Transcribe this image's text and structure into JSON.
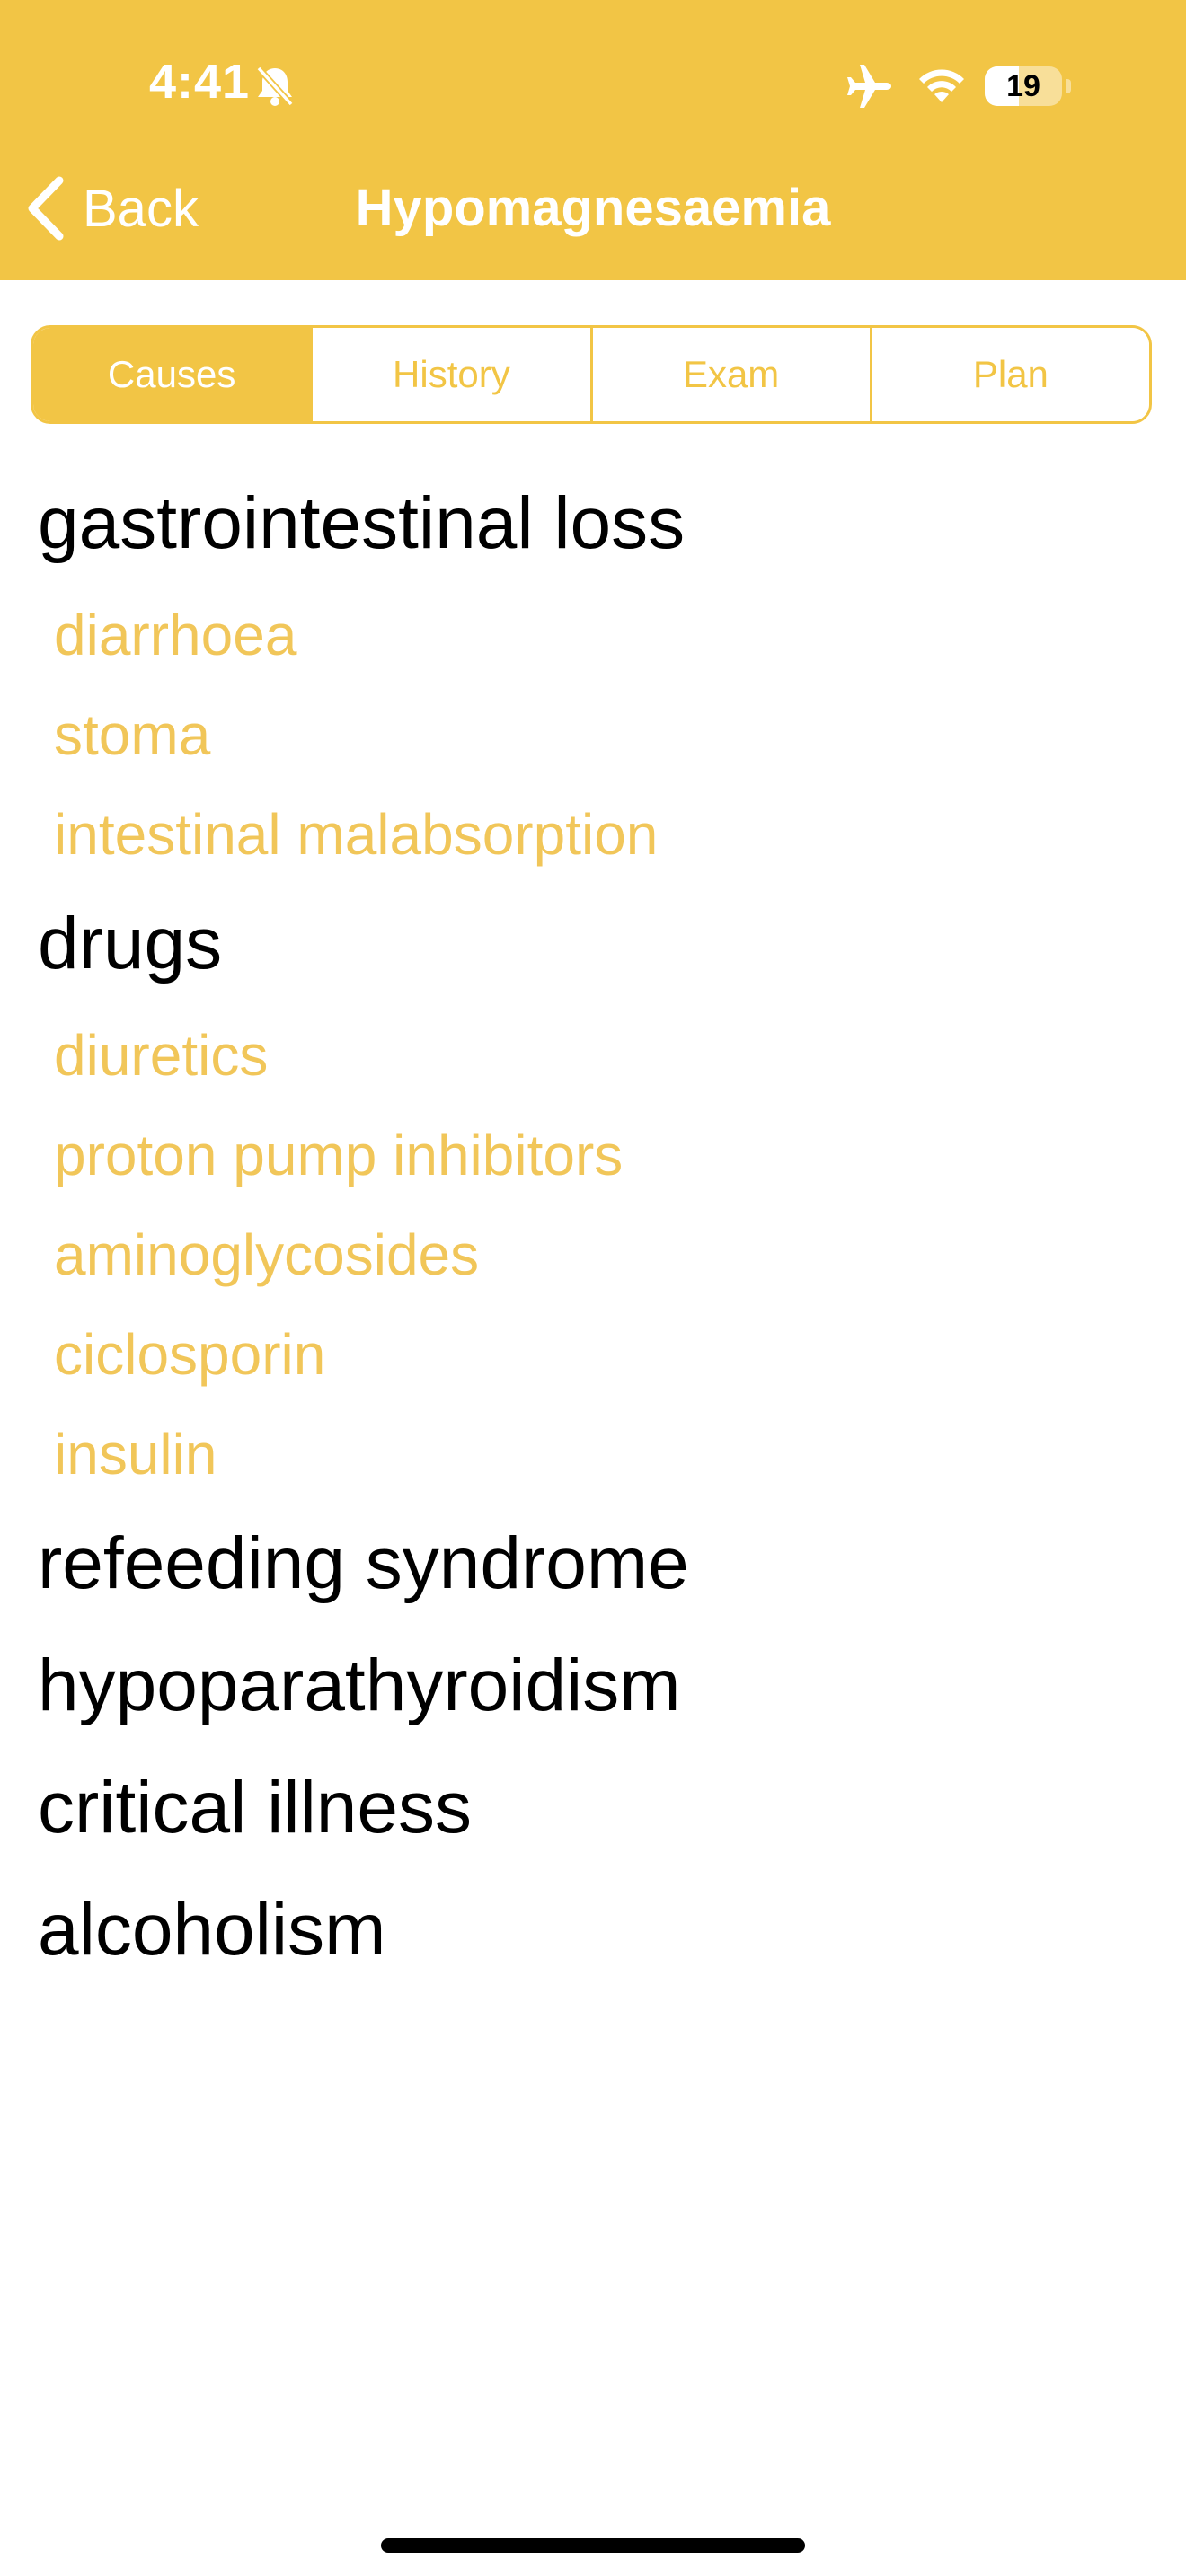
{
  "status_bar": {
    "time": "4:41",
    "battery": "19"
  },
  "nav": {
    "back_label": "Back",
    "title": "Hypomagnesaemia"
  },
  "tabs": [
    {
      "label": "Causes"
    },
    {
      "label": "History"
    },
    {
      "label": "Exam"
    },
    {
      "label": "Plan"
    }
  ],
  "content": {
    "sections": [
      {
        "title": "gastrointestinal loss",
        "items": [
          "diarrhoea",
          "stoma",
          "intestinal malabsorption"
        ]
      },
      {
        "title": "drugs",
        "items": [
          "diuretics",
          "proton pump inhibitors",
          "aminoglycosides",
          "ciclosporin",
          "insulin"
        ]
      },
      {
        "title": "refeeding syndrome",
        "items": []
      },
      {
        "title": "hypoparathyroidism",
        "items": []
      },
      {
        "title": "critical illness",
        "items": []
      },
      {
        "title": "alcoholism",
        "items": []
      }
    ]
  }
}
